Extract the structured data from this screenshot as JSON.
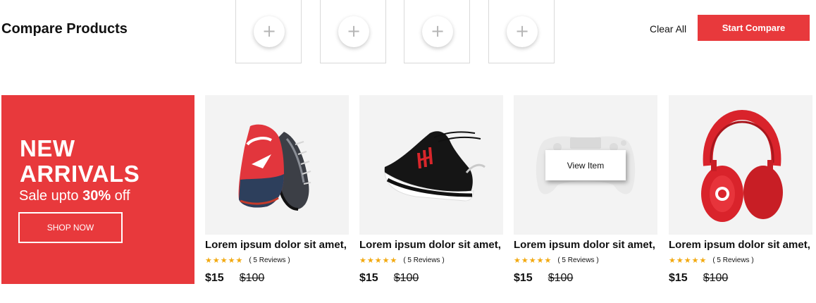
{
  "compare": {
    "title": "Compare Products",
    "slots": [
      "+",
      "+",
      "+",
      "+"
    ],
    "clear_all": "Clear All",
    "start_compare": "Start Compare"
  },
  "promo": {
    "line1": "NEW",
    "line2": "ARRIVALS",
    "sale_prefix": "Sale upto ",
    "sale_value": "30%",
    "sale_suffix": " off",
    "button": "SHOP NOW"
  },
  "products": [
    {
      "name": "Lorem ipsum dolor sit amet,",
      "stars": "★★★★★",
      "rating": 5,
      "reviews": "( 5 Reviews )",
      "price": "$15",
      "old_price": "$100",
      "image": "running-shoes"
    },
    {
      "name": "Lorem ipsum dolor sit amet,",
      "stars": "★★★★★",
      "rating": 5,
      "reviews": "( 5 Reviews )",
      "price": "$15",
      "old_price": "$100",
      "image": "black-sneaker"
    },
    {
      "name": "Lorem ipsum dolor sit amet,",
      "stars": "★★★★★",
      "rating": 5,
      "reviews": "( 5 Reviews )",
      "price": "$15",
      "old_price": "$100",
      "image": "game-controller",
      "overlay": "View Item"
    },
    {
      "name": "Lorem ipsum dolor sit amet,",
      "stars": "★★★★★",
      "rating": 5,
      "reviews": "( 5 Reviews )",
      "price": "$15",
      "old_price": "$100",
      "image": "red-headphones"
    }
  ],
  "colors": {
    "accent": "#e8393c",
    "star": "#f2a90f",
    "card_bg": "#f3f3f3"
  }
}
